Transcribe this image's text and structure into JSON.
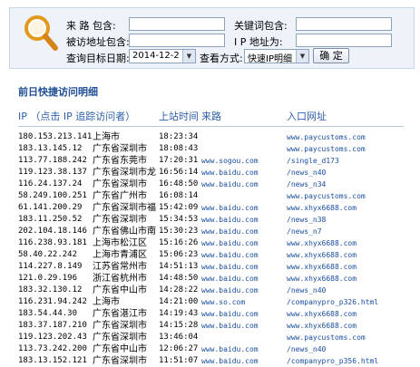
{
  "search": {
    "visit_page_label": "来 路 包含:",
    "visited_url_label": "被访地址包含:",
    "query_date_label": "查询目标日期:",
    "keyword_label": "关键词包含:",
    "ip_label": "I P 地址为:",
    "view_mode_label": "查看方式:",
    "date_value": "2014-12-2",
    "view_mode_value": "快速IP明细",
    "confirm_label": "确 定"
  },
  "section_title": "前日快捷访问明细",
  "table": {
    "headers": {
      "ip": "IP （点击 IP 追踪访问者）",
      "time": "上站时间",
      "source": "来路",
      "entry": "入口网址"
    },
    "rows": [
      {
        "ip": "180.153.213.141",
        "loc": "上海市",
        "time": "18:23:34",
        "src": "",
        "entry": "www.paycustoms.com"
      },
      {
        "ip": "183.13.145.12",
        "loc": "广东省深圳市",
        "time": "18:08:43",
        "src": "",
        "entry": "www.paycustoms.com"
      },
      {
        "ip": "113.77.188.242",
        "loc": "广东省东莞市",
        "time": "17:20:31",
        "src": "www.sogou.com",
        "entry": "/single_d173"
      },
      {
        "ip": "119.123.38.137",
        "loc": "广东省深圳市龙",
        "time": "16:56:14",
        "src": "www.baidu.com",
        "entry": "/news_n40"
      },
      {
        "ip": "116.24.137.24",
        "loc": "广东省深圳市",
        "time": "16:48:50",
        "src": "www.baidu.com",
        "entry": "/news_n34"
      },
      {
        "ip": "58.249.100.251",
        "loc": "广东省广州市",
        "time": "16:08:14",
        "src": "",
        "entry": "www.paycustoms.com"
      },
      {
        "ip": "61.141.200.29",
        "loc": "广东省深圳市福",
        "time": "15:42:09",
        "src": "www.baidu.com",
        "entry": "www.xhyx6688.com"
      },
      {
        "ip": "183.11.250.52",
        "loc": "广东省深圳市",
        "time": "15:34:53",
        "src": "www.baidu.com",
        "entry": "/news_n38"
      },
      {
        "ip": "202.104.18.146",
        "loc": "广东省佛山市南",
        "time": "15:30:23",
        "src": "www.baidu.com",
        "entry": "/news_n7"
      },
      {
        "ip": "116.238.93.181",
        "loc": "上海市松江区",
        "time": "15:16:26",
        "src": "www.baidu.com",
        "entry": "www.xhyx6688.com"
      },
      {
        "ip": "58.40.22.242",
        "loc": "上海市青浦区",
        "time": "15:06:23",
        "src": "www.baidu.com",
        "entry": "www.xhyx6688.com"
      },
      {
        "ip": "114.227.8.149",
        "loc": "江苏省常州市",
        "time": "14:51:13",
        "src": "www.baidu.com",
        "entry": "www.xhyx6688.com"
      },
      {
        "ip": "121.0.29.196",
        "loc": "浙江省杭州市",
        "time": "14:48:50",
        "src": "www.baidu.com",
        "entry": "www.xhyx6688.com"
      },
      {
        "ip": "183.32.130.12",
        "loc": "广东省中山市",
        "time": "14:28:22",
        "src": "www.baidu.com",
        "entry": "/news_n40"
      },
      {
        "ip": "116.231.94.242",
        "loc": "上海市",
        "time": "14:21:00",
        "src": "www.so.com",
        "entry": "/companypro_p326.html"
      },
      {
        "ip": "183.54.44.30",
        "loc": "广东省湛江市",
        "time": "14:19:43",
        "src": "www.baidu.com",
        "entry": "www.xhyx6688.com"
      },
      {
        "ip": "183.37.187.210",
        "loc": "广东省深圳市",
        "time": "14:15:28",
        "src": "www.baidu.com",
        "entry": "www.xhyx6688.com"
      },
      {
        "ip": "119.123.202.43",
        "loc": "广东省深圳市",
        "time": "13:46:04",
        "src": "",
        "entry": "www.paycustoms.com"
      },
      {
        "ip": "113.73.242.200",
        "loc": "广东省中山市",
        "time": "12:06:27",
        "src": "www.baidu.com",
        "entry": "/news_n40"
      },
      {
        "ip": "183.13.152.121",
        "loc": "广东省深圳市",
        "time": "11:51:07",
        "src": "www.baidu.com",
        "entry": "/companypro_p356.html"
      }
    ]
  },
  "colors": {
    "panel_bg": "#eef3fa",
    "header_text": "#2c5fa8",
    "title_text": "#1f4e96",
    "link_text": "#1a4fa0"
  },
  "icons": {
    "search_panel": "magnifier-icon",
    "select_arrow": "chevron-down-icon"
  }
}
